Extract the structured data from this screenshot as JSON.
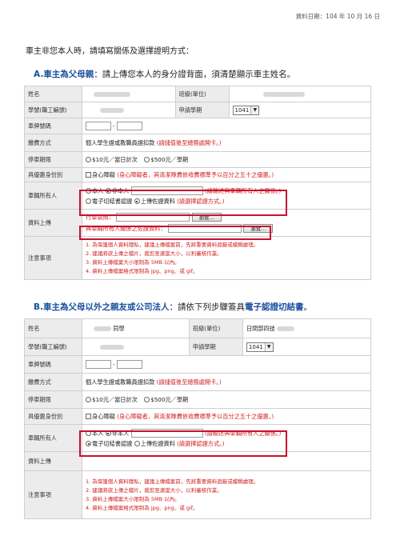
{
  "header": {
    "date": "資料日期：104 年 10 月 16 日"
  },
  "intro": "車主非您本人時，請填寫關係及選擇證明方式：",
  "section_a": {
    "prefix": "A.",
    "title_em": "車主為父母親",
    "title_rest": "：請上傳您本人的身分證背面，須清楚顯示車主姓名。",
    "form": {
      "name_label": "姓名",
      "class_label": "班級(單位)",
      "id_label": "學號(職工編號)",
      "term_label": "申請學期",
      "term_value": "1041",
      "plate_label": "車牌號碼",
      "plate_sep": "-",
      "pay_label": "繳費方式",
      "pay_text": "個人學生證或教職員證扣款",
      "pay_note": "(請儲值後至總務處開卡。)",
      "period_label": "停車期限",
      "period_opt1": "$10元／當日計次",
      "period_opt2": "$500元／學期",
      "identity_label": "具優惠身份別",
      "identity_opt": "身心障礙",
      "identity_note": "(身心障礙者，其清潔隊費依收費標準予以百分之五十之優惠。)",
      "owner_label": "車輛所有人",
      "owner_self": "本人",
      "owner_other": "非本人",
      "owner_note": "(請輸述與車輛所有人之關係。)",
      "proof_ecert": "電子切結書認證",
      "proof_upload": "上傳佐證資料",
      "proof_note": "(請選擇認證方式。)",
      "upload_label": "資料上傳",
      "license_label": "行車執照：",
      "browse": "瀏覽...",
      "relation_label": "與車輛所有人關係之佐證資料：",
      "notes_label": "注意事項",
      "notes": [
        "1. 為保護個人資料隱私，建議上傳檔案前，先將重要資料遮蔽或模糊處理。",
        "2. 建議將欲上傳之檔片，裁剪至適當大小，以利審核作業。",
        "3. 資料上傳檔案大小限制為 5MB 以內。",
        "4. 資料上傳檔案格式限制為 jpg、png、或 gif。"
      ]
    }
  },
  "section_b": {
    "prefix": "B.",
    "title_em1": "車主為父母以外之親友或公司法人",
    "title_mid": "：請依下列步驟簽具",
    "title_em2": "電子認證切結書",
    "title_end": "。",
    "form": {
      "name_label": "姓名",
      "name_suffix": "同學",
      "class_label": "班級(單位)",
      "class_value": "日間部四技",
      "id_label": "學號(職工編號)",
      "term_label": "申請學期",
      "term_value": "1041",
      "plate_label": "車牌號碼",
      "plate_sep": "-",
      "pay_label": "繳費方式",
      "pay_text": "個人學生證或教職員證扣款",
      "pay_note": "(請儲值後至總務處開卡。)",
      "period_label": "停車期限",
      "period_opt1": "$10元／當日計次",
      "period_opt2": "$500元／學期",
      "identity_label": "具優惠身份別",
      "identity_opt": "身心障礙",
      "identity_note": "(身心障礙者，其清潔隊費依收費標準予以百分之五十之優惠。)",
      "owner_label": "車輛所有人",
      "owner_self": "本人",
      "owner_other": "非本人",
      "owner_note": "(請輸述與車輛所有人之關係。)",
      "proof_ecert": "電子切結書認證",
      "proof_upload": "上傳佐證資料",
      "proof_note": "(請選擇認證方式。)",
      "upload_label": "資料上傳",
      "notes_label": "注意事項",
      "notes": [
        "1. 為保護個人資料隱私，建議上傳檔案前，先將重要資料遮蔽或模糊處理。",
        "2. 建議將欲上傳之檔片，裁剪至適當大小，以利審核作業。",
        "3. 資料上傳檔案大小限制為 5MB 以內。",
        "4. 資料上傳檔案格式限制為 jpg、png、或 gif。"
      ]
    }
  }
}
